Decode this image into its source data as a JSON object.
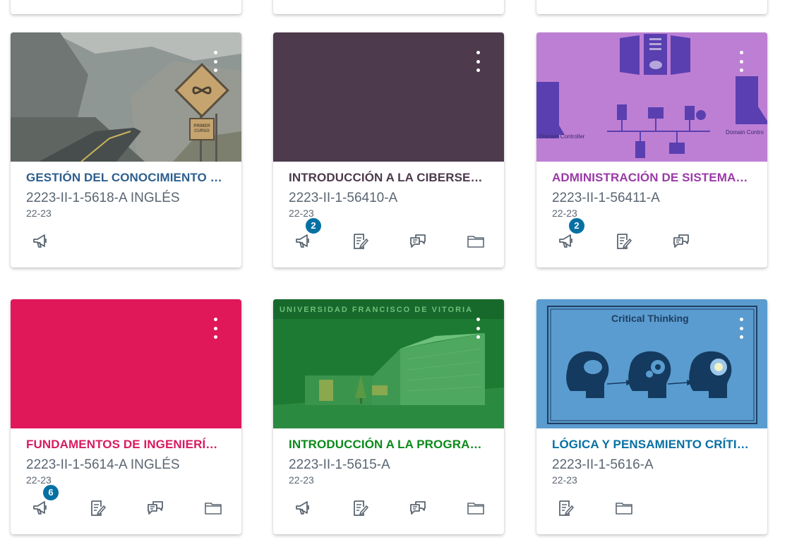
{
  "cards": [
    {
      "title": "GESTIÓN DEL CONOCIMIENTO …",
      "code": "2223-II-1-5618-A INGLÉS",
      "term": "22-23",
      "color": "#2d6ea8",
      "hero_color": "#8c9190",
      "hero_sign": [
        "PRIMER",
        "CURSO"
      ],
      "announcement_badge": null,
      "actions": [
        "megaphone-icon"
      ]
    },
    {
      "title": "INTRODUCCIÓN A LA CIBERSEG…",
      "code": "2223-II-1-56410-A",
      "term": "22-23",
      "color": "#4c3a4c",
      "hero_color": "#4d3a4c",
      "announcement_badge": "2",
      "actions": [
        "megaphone-icon",
        "assignment-icon",
        "discussion-icon",
        "folder-icon"
      ]
    },
    {
      "title": "ADMINISTRACIÓN DE SISTEMAS…",
      "code": "2223-II-1-56411-A",
      "term": "22-23",
      "color": "#9a3aa8",
      "hero_color": "#bd7fd4",
      "hero_labels": [
        "Domain Controller",
        "Domain Contro"
      ],
      "announcement_badge": "2",
      "actions": [
        "megaphone-icon",
        "assignment-icon",
        "discussion-icon"
      ]
    },
    {
      "title": "FUNDAMENTOS DE INGENIERÍA…",
      "code": "2223-II-1-5614-A INGLÉS",
      "term": "22-23",
      "color": "#d81b60",
      "hero_color": "#e0185a",
      "announcement_badge": "6",
      "actions": [
        "megaphone-icon",
        "assignment-icon",
        "discussion-icon",
        "folder-icon"
      ]
    },
    {
      "title": "INTRODUCCIÓN A LA PROGRA…",
      "code": "2223-II-1-5615-A",
      "term": "22-23",
      "color": "#0b8a1a",
      "hero_color": "#1d7a32",
      "hero_banner": "UNIVERSIDAD FRANCISCO DE VITORIA",
      "announcement_badge": null,
      "actions": [
        "megaphone-icon",
        "assignment-icon",
        "discussion-icon",
        "folder-icon"
      ]
    },
    {
      "title": "LÓGICA Y PENSAMIENTO CRÍTIC…",
      "code": "2223-II-1-5616-A",
      "term": "22-23",
      "color": "#0770a3",
      "hero_color": "#5a9ccf",
      "hero_heading": "Critical Thinking",
      "announcement_badge": null,
      "actions": [
        "assignment-icon",
        "folder-icon"
      ]
    }
  ]
}
